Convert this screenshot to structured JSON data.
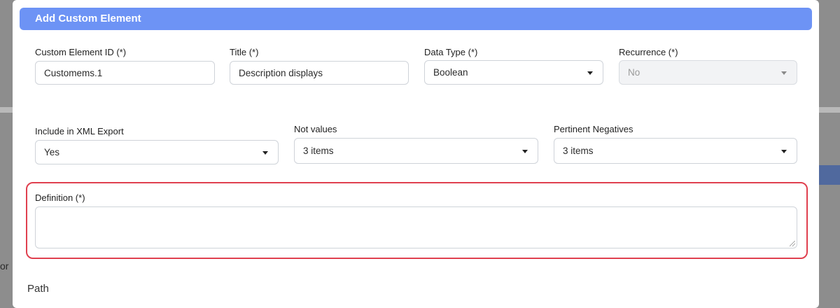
{
  "modal": {
    "title": "Add Custom Element"
  },
  "fields": {
    "custom_element_id": {
      "label": "Custom Element ID (*)",
      "value": "Customems.1"
    },
    "title": {
      "label": "Title (*)",
      "value": "Description displays"
    },
    "data_type": {
      "label": "Data Type (*)",
      "value": "Boolean"
    },
    "recurrence": {
      "label": "Recurrence (*)",
      "value": "No"
    },
    "include_xml": {
      "label": "Include in XML Export",
      "value": "Yes"
    },
    "not_values": {
      "label": "Not values",
      "value": "3 items"
    },
    "pertinent_negatives": {
      "label": "Pertinent Negatives",
      "value": "3 items"
    },
    "definition": {
      "label": "Definition (*)",
      "value": ""
    }
  },
  "section": {
    "path_title": "Path"
  },
  "background": {
    "partial_text": "or"
  },
  "colors": {
    "header": "#6d93f5",
    "highlight": "#e0404f"
  }
}
